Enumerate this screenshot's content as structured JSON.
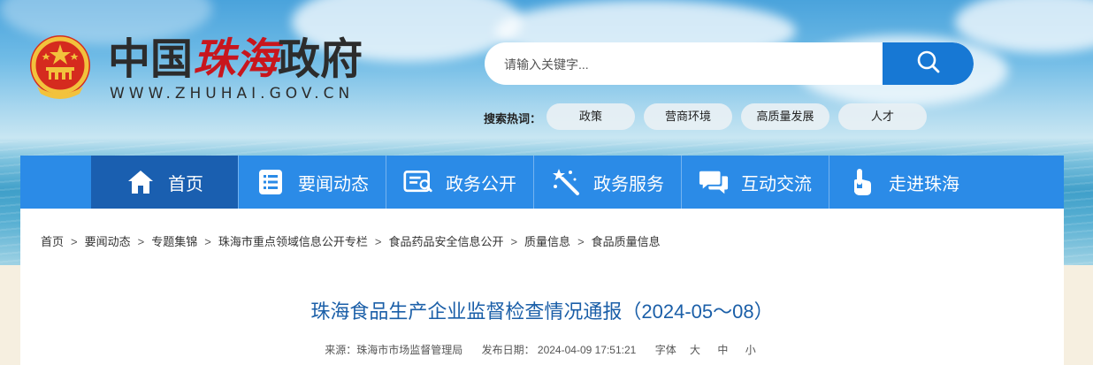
{
  "header": {
    "title_prefix": "中国",
    "title_brand": "珠海",
    "title_suffix": "政府",
    "url": "WWW.ZHUHAI.GOV.CN",
    "emblem_icon": "national-emblem-icon"
  },
  "search": {
    "placeholder": "请输入关键字...",
    "button_icon": "search-icon",
    "hot_label": "搜索热词：",
    "hot_words": [
      "政策",
      "营商环境",
      "高质量发展",
      "人才"
    ]
  },
  "nav": {
    "items": [
      {
        "label": "首页",
        "icon": "home-icon",
        "active": true
      },
      {
        "label": "要闻动态",
        "icon": "news-list-icon"
      },
      {
        "label": "政务公开",
        "icon": "open-info-icon"
      },
      {
        "label": "政务服务",
        "icon": "magic-wand-icon"
      },
      {
        "label": "互动交流",
        "icon": "chat-bubbles-icon"
      },
      {
        "label": "走进珠海",
        "icon": "pointer-hand-icon"
      }
    ],
    "active_color": "#1a5fb0",
    "bar_color": "#2b8be7"
  },
  "breadcrumb": {
    "sep": ">",
    "items": [
      "首页",
      "要闻动态",
      "专题集锦",
      "珠海市重点领域信息公开专栏",
      "食品药品安全信息公开",
      "质量信息",
      "食品质量信息"
    ]
  },
  "article": {
    "title": "珠海食品生产企业监督检查情况通报（2024-05～08）",
    "source": "来源：珠海市市场监督管理局",
    "date": "发布日期： 2024-04-09 17:51:21",
    "font_label": "字体",
    "font_sizes": [
      "大",
      "中",
      "小"
    ]
  }
}
